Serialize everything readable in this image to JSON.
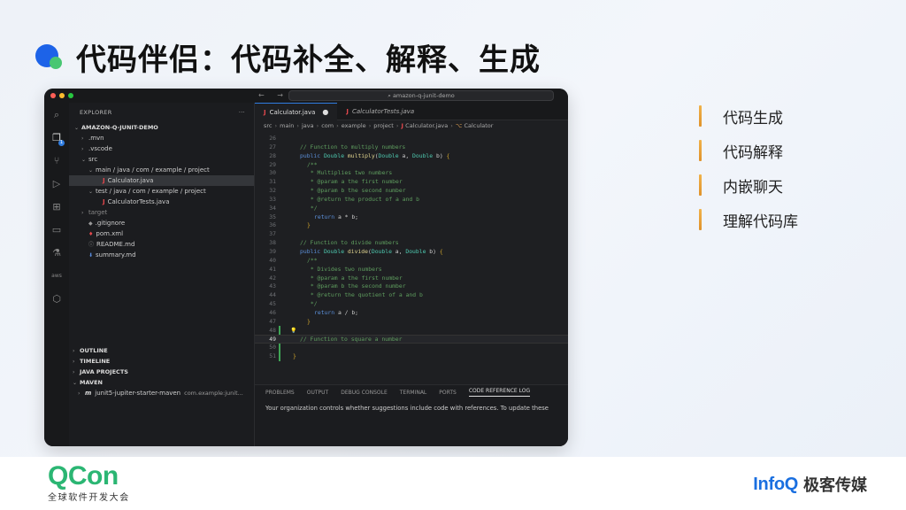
{
  "slide": {
    "title": "代码伴侣：代码补全、解释、生成"
  },
  "features": [
    {
      "label": "代码生成",
      "bar_color": "#e8a33a"
    },
    {
      "label": "代码解释",
      "bar_color": "#e8a33a"
    },
    {
      "label": "内嵌聊天",
      "bar_color": "#e8a33a"
    },
    {
      "label": "理解代码库",
      "bar_color": "#e8a33a"
    }
  ],
  "ide": {
    "command_center": "amazon-q-junit-demo",
    "explorer_header": "EXPLORER",
    "explorer_more": "···",
    "tree": [
      {
        "label": "AMAZON-Q-JUNIT-DEMO",
        "indent": 0,
        "chev": "⌄",
        "style": "bold"
      },
      {
        "label": ".mvn",
        "indent": 1,
        "chev": "›"
      },
      {
        "label": ".vscode",
        "indent": 1,
        "chev": "›"
      },
      {
        "label": "src",
        "indent": 1,
        "chev": "⌄"
      },
      {
        "label": "main / java / com / example / project",
        "indent": 2,
        "chev": "⌄"
      },
      {
        "label": "Calculator.java",
        "indent": 3,
        "icon": "J",
        "selected": true
      },
      {
        "label": "test / java / com / example / project",
        "indent": 2,
        "chev": "⌄"
      },
      {
        "label": "CalculatorTests.java",
        "indent": 3,
        "icon": "J"
      },
      {
        "label": "target",
        "indent": 1,
        "chev": "›",
        "style": "dim"
      },
      {
        "label": ".gitignore",
        "indent": 1,
        "icon": "◆"
      },
      {
        "label": "pom.xml",
        "indent": 1,
        "icon": "♦"
      },
      {
        "label": "README.md",
        "indent": 1,
        "icon": "ⓘ"
      },
      {
        "label": "summary.md",
        "indent": 1,
        "icon": "⬇"
      }
    ],
    "sections": [
      {
        "label": "OUTLINE",
        "chev": "›"
      },
      {
        "label": "TIMELINE",
        "chev": "›"
      },
      {
        "label": "JAVA PROJECTS",
        "chev": "›"
      },
      {
        "label": "MAVEN",
        "chev": "⌄"
      }
    ],
    "maven_item": {
      "label": "junit5-jupiter-starter-maven",
      "extra": "com.example:junit..."
    },
    "tabs": [
      {
        "label": "Calculator.java",
        "active": true,
        "modified": "●"
      },
      {
        "label": "CalculatorTests.java",
        "active": false
      }
    ],
    "breadcrumb": [
      "src",
      "main",
      "java",
      "com",
      "example",
      "project",
      "Calculator.java",
      "Calculator"
    ],
    "code_lines": [
      {
        "n": "26",
        "t": ""
      },
      {
        "n": "27",
        "t": "// Function to multiply numbers"
      },
      {
        "n": "28",
        "t": "public Double multiply(Double a, Double b) {"
      },
      {
        "n": "29",
        "t": "/**"
      },
      {
        "n": "30",
        "t": " * Multiplies two numbers"
      },
      {
        "n": "31",
        "t": " * @param a the first number"
      },
      {
        "n": "32",
        "t": " * @param b the second number"
      },
      {
        "n": "33",
        "t": " * @return the product of a and b"
      },
      {
        "n": "34",
        "t": " */"
      },
      {
        "n": "35",
        "t": "return a * b;"
      },
      {
        "n": "36",
        "t": "}"
      },
      {
        "n": "37",
        "t": ""
      },
      {
        "n": "38",
        "t": "// Function to divide numbers"
      },
      {
        "n": "39",
        "t": "public Double divide(Double a, Double b) {"
      },
      {
        "n": "40",
        "t": "/**"
      },
      {
        "n": "41",
        "t": " * Divides two numbers"
      },
      {
        "n": "42",
        "t": " * @param a the first number"
      },
      {
        "n": "43",
        "t": " * @param b the second number"
      },
      {
        "n": "44",
        "t": " * @return the quotient of a and b"
      },
      {
        "n": "45",
        "t": " */"
      },
      {
        "n": "46",
        "t": "return a / b;"
      },
      {
        "n": "47",
        "t": "}"
      },
      {
        "n": "48",
        "t": ""
      },
      {
        "n": "49",
        "t": "// Function to square a number"
      },
      {
        "n": "50",
        "t": ""
      },
      {
        "n": "51",
        "t": "}"
      }
    ],
    "panel_tabs": [
      "PROBLEMS",
      "OUTPUT",
      "DEBUG CONSOLE",
      "TERMINAL",
      "PORTS",
      "CODE REFERENCE LOG"
    ],
    "panel_active": "CODE REFERENCE LOG",
    "panel_message": "Your organization controls whether suggestions include code with references. To update these"
  },
  "footer": {
    "qcon_logo": "QCon",
    "qcon_sub": "全球软件开发大会",
    "infoq_brand": "InfoQ",
    "infoq_cn": "极客传媒"
  },
  "colors": {
    "accent_blue": "#1d63e8",
    "accent_green": "#48c772",
    "qcon_green": "#2bb673",
    "infoq_blue": "#1a6fe0"
  }
}
